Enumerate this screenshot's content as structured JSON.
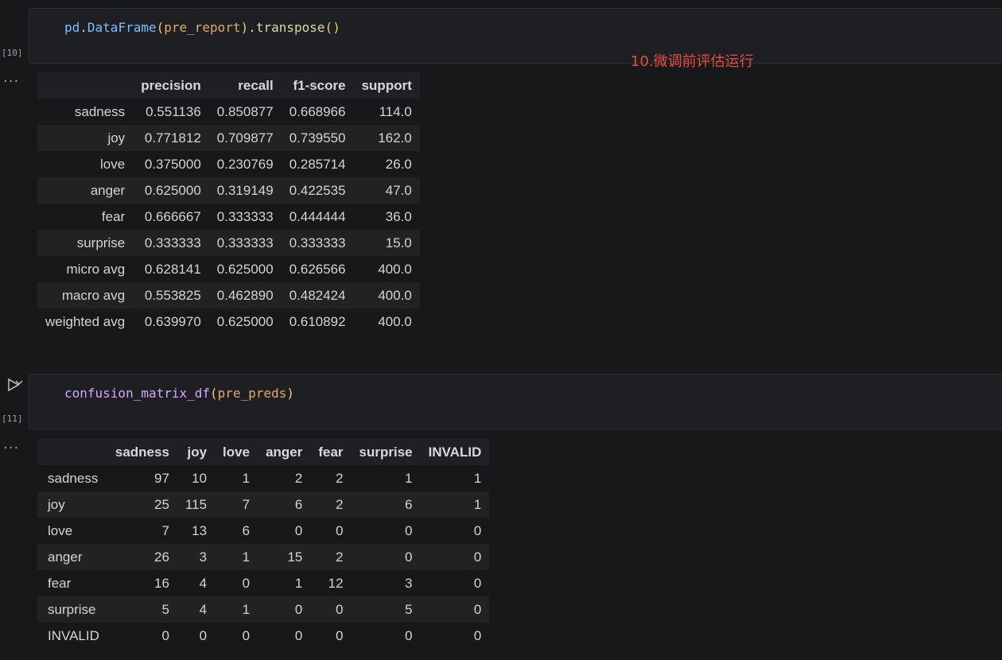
{
  "cells": [
    {
      "exec_count": "[10]",
      "code": {
        "obj": "pd",
        "dot1": ".",
        "cls": "DataFrame",
        "open1": "(",
        "arg": "pre_report",
        "close1": ")",
        "dot2": ".",
        "method": "transpose",
        "open2": "(",
        "close2": ")"
      }
    },
    {
      "exec_count": "[11]",
      "code": {
        "fn": "confusion_matrix_df",
        "open": "(",
        "arg": "pre_preds",
        "close": ")"
      }
    }
  ],
  "more_glyph": "···",
  "annotation": "10.微调前评估运行",
  "report_table": {
    "columns": [
      "",
      "precision",
      "recall",
      "f1-score",
      "support"
    ],
    "rows": [
      [
        "sadness",
        "0.551136",
        "0.850877",
        "0.668966",
        "114.0"
      ],
      [
        "joy",
        "0.771812",
        "0.709877",
        "0.739550",
        "162.0"
      ],
      [
        "love",
        "0.375000",
        "0.230769",
        "0.285714",
        "26.0"
      ],
      [
        "anger",
        "0.625000",
        "0.319149",
        "0.422535",
        "47.0"
      ],
      [
        "fear",
        "0.666667",
        "0.333333",
        "0.444444",
        "36.0"
      ],
      [
        "surprise",
        "0.333333",
        "0.333333",
        "0.333333",
        "15.0"
      ],
      [
        "micro avg",
        "0.628141",
        "0.625000",
        "0.626566",
        "400.0"
      ],
      [
        "macro avg",
        "0.553825",
        "0.462890",
        "0.482424",
        "400.0"
      ],
      [
        "weighted avg",
        "0.639970",
        "0.625000",
        "0.610892",
        "400.0"
      ]
    ]
  },
  "confusion_table": {
    "columns": [
      "",
      "sadness",
      "joy",
      "love",
      "anger",
      "fear",
      "surprise",
      "INVALID"
    ],
    "rows": [
      [
        "sadness",
        "97",
        "10",
        "1",
        "2",
        "2",
        "1",
        "1"
      ],
      [
        "joy",
        "25",
        "115",
        "7",
        "6",
        "2",
        "6",
        "1"
      ],
      [
        "love",
        "7",
        "13",
        "6",
        "0",
        "0",
        "0",
        "0"
      ],
      [
        "anger",
        "26",
        "3",
        "1",
        "15",
        "2",
        "0",
        "0"
      ],
      [
        "fear",
        "16",
        "4",
        "0",
        "1",
        "12",
        "3",
        "0"
      ],
      [
        "surprise",
        "5",
        "4",
        "1",
        "0",
        "0",
        "5",
        "0"
      ],
      [
        "INVALID",
        "0",
        "0",
        "0",
        "0",
        "0",
        "0",
        "0"
      ]
    ]
  },
  "colors": {
    "annotation": "#e74c3c",
    "background": "#17181a"
  }
}
